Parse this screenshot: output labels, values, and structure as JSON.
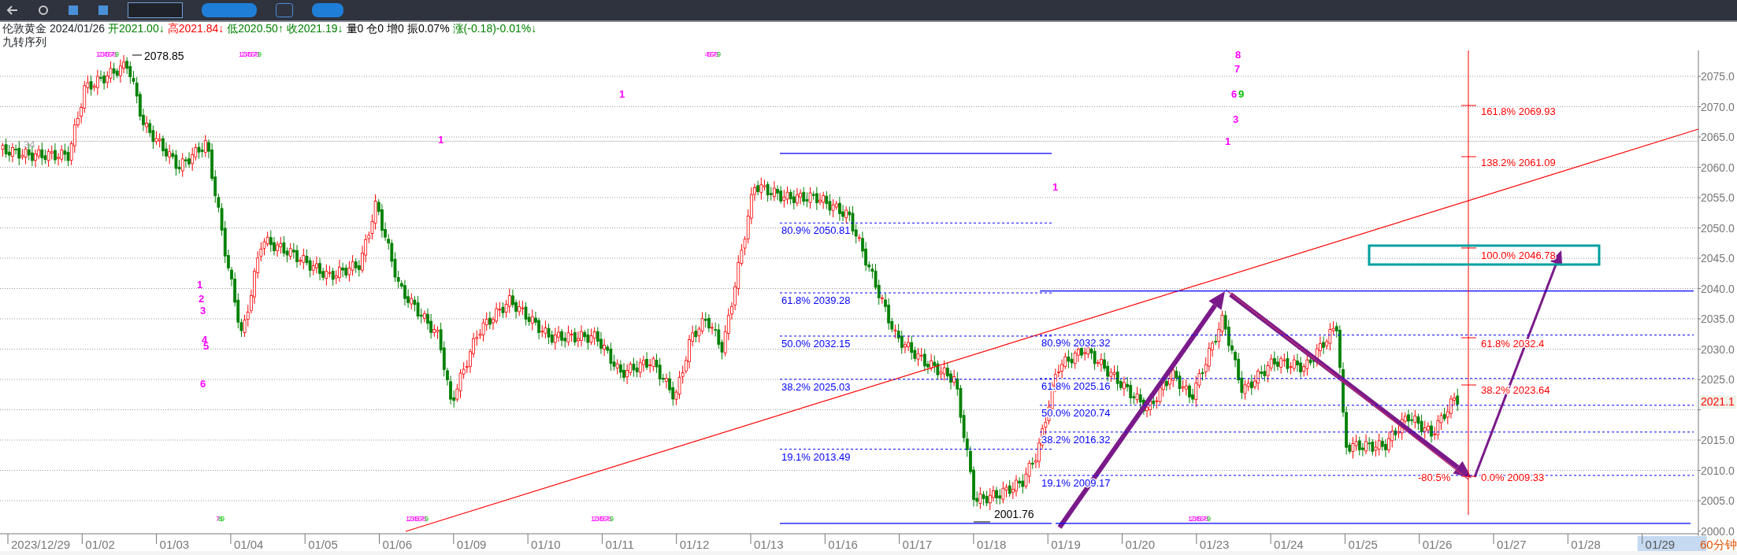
{
  "quote": {
    "symbol": "伦敦黄金",
    "date": "2024/01/26",
    "fields": [
      {
        "text": "开2021.00↓",
        "color": "#008000"
      },
      {
        "text": "高2021.84↓",
        "color": "#ff0000"
      },
      {
        "text": "低2020.50↑",
        "color": "#008000"
      },
      {
        "text": "收2021.19↓",
        "color": "#008000"
      },
      {
        "text": "量0",
        "color": "#000000"
      },
      {
        "text": "仓0",
        "color": "#000000"
      },
      {
        "text": "增0",
        "color": "#000000"
      },
      {
        "text": "振0.07%",
        "color": "#000000"
      },
      {
        "text": "涨(-0.18)-0.01%↓",
        "color": "#008000"
      }
    ]
  },
  "indicator": "九转序列",
  "chart": {
    "price_axis": [
      "2075.0",
      "2070.0",
      "2065.0",
      "2060.0",
      "2055.0",
      "2050.0",
      "2045.0",
      "2040.0",
      "2035.0",
      "2030.0",
      "2025.0",
      "2015.0",
      "2010.0",
      "2005.0",
      "2000.0"
    ],
    "last_price": "2021.1",
    "high_label": "2078.85",
    "low_label": "2001.76",
    "left_label": "34",
    "fib_left": [
      "80.9% 2050.81",
      "61.8% 2039.28",
      "50.0% 2032.15",
      "38.2% 2025.03",
      "19.1% 2013.49"
    ],
    "fib_right": [
      "80.9% 2032.32",
      "61.8% 2025.16",
      "50.0% 2020.74",
      "38.2% 2016.32",
      "19.1% 2009.17"
    ],
    "fib_ext": [
      "161.8% 2069.93",
      "138.2% 2061.09",
      "100.0% 2046.78",
      "61.8% 2032.4",
      "38.2% 2023.64",
      "-80.5%",
      "0.0% 2009.33"
    ],
    "td_groups": [
      {
        "digits": "12345678",
        "tail": "9"
      },
      {
        "digits": "12345678",
        "tail": "9"
      },
      {
        "digits": "45678",
        "tail": "9"
      },
      {
        "digits": "7",
        "tail": "89"
      },
      {
        "digits": "12345678",
        "tail": "9"
      },
      {
        "digits": "12345678",
        "tail": "9"
      },
      {
        "digits": "12345678",
        "tail": "9"
      }
    ],
    "td_singles": [
      {
        "text": "1",
        "color": "#ff00ff"
      },
      {
        "text": "2",
        "color": "#ff00ff"
      },
      {
        "text": "3",
        "color": "#ff00ff"
      },
      {
        "text": "4",
        "color": "#ff00ff"
      },
      {
        "text": "5",
        "color": "#ff00ff"
      },
      {
        "text": "6",
        "color": "#ff00ff"
      },
      {
        "text": "1",
        "color": "#ff00ff"
      },
      {
        "text": "1",
        "color": "#ff00ff"
      },
      {
        "text": "1",
        "color": "#ff00ff"
      },
      {
        "text": "8",
        "color": "#ff00ff"
      },
      {
        "text": "7",
        "color": "#ff00ff"
      },
      {
        "text": "6",
        "color": "#ff00ff"
      },
      {
        "text": "9",
        "color": "#00c000"
      },
      {
        "text": "3",
        "color": "#ff00ff"
      },
      {
        "text": "1",
        "color": "#ff00ff"
      }
    ],
    "dates": [
      {
        "label": "2023/12/29",
        "selected": false
      },
      {
        "label": "01/02",
        "selected": false
      },
      {
        "label": "01/03",
        "selected": false
      },
      {
        "label": "01/04",
        "selected": false
      },
      {
        "label": "01/05",
        "selected": false
      },
      {
        "label": "01/06",
        "selected": false
      },
      {
        "label": "01/09",
        "selected": false
      },
      {
        "label": "01/10",
        "selected": false
      },
      {
        "label": "01/11",
        "selected": false
      },
      {
        "label": "01/12",
        "selected": false
      },
      {
        "label": "01/13",
        "selected": false
      },
      {
        "label": "01/16",
        "selected": false
      },
      {
        "label": "01/17",
        "selected": false
      },
      {
        "label": "01/18",
        "selected": false
      },
      {
        "label": "01/19",
        "selected": false
      },
      {
        "label": "01/20",
        "selected": false
      },
      {
        "label": "01/23",
        "selected": false
      },
      {
        "label": "01/24",
        "selected": false
      },
      {
        "label": "01/25",
        "selected": false
      },
      {
        "label": "01/26",
        "selected": false
      },
      {
        "label": "01/27",
        "selected": false
      },
      {
        "label": "01/28",
        "selected": false
      },
      {
        "label": "01/29",
        "selected": true
      }
    ],
    "period": "60分钟"
  }
}
